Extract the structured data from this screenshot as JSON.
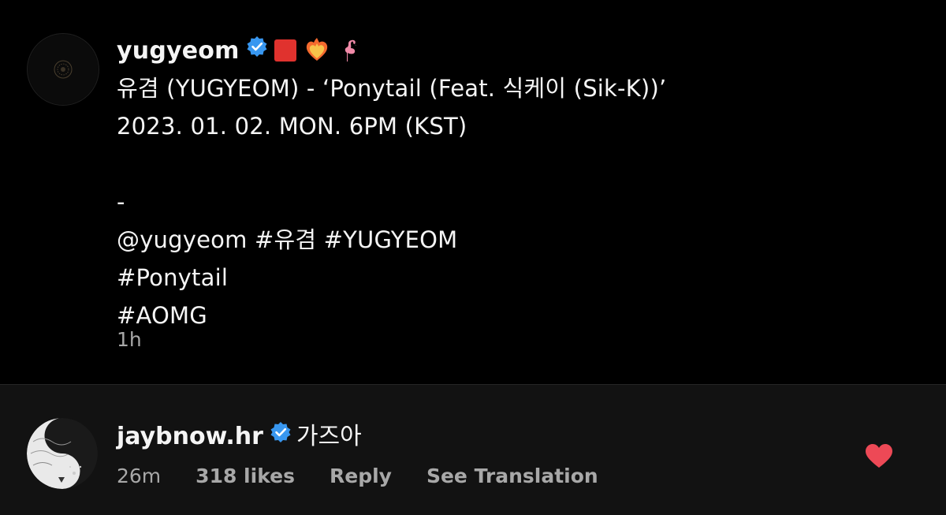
{
  "post": {
    "username": "yugyeom",
    "caption_lines": [
      "유겸 (YUGYEOM) - ‘Ponytail (Feat. 식케이 (Sik-K))’",
      "2023. 01. 02. MON. 6PM (KST)",
      "",
      "-",
      "@yugyeom #유겸 #YUGYEOM",
      "#Ponytail",
      "#AOMG"
    ],
    "emojis": [
      "red-square-icon",
      "heart-on-fire-icon",
      "flamingo-icon"
    ],
    "time": "1h"
  },
  "comment": {
    "username": "jaybnow.hr",
    "text": "가즈아",
    "time": "26m",
    "likes": "318 likes",
    "reply_label": "Reply",
    "translate_label": "See Translation",
    "liked": true
  },
  "colors": {
    "background": "#000000",
    "comment_background": "#121212",
    "verified": "#3897f0",
    "heart": "#ed4956",
    "muted_text": "#a8a8a8"
  }
}
